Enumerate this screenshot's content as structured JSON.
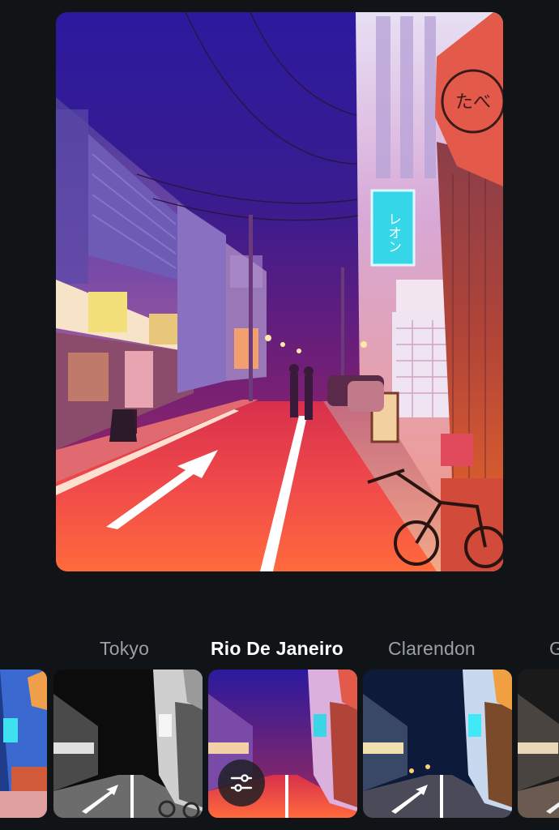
{
  "editor": {
    "selected_filter": "Rio De Janeiro",
    "filters": [
      {
        "label": "Tokyo"
      },
      {
        "label": "Rio De Janeiro"
      },
      {
        "label": "Clarendon"
      },
      {
        "label": "G"
      }
    ],
    "photo_signs": {
      "blue_sign": "レオン",
      "hanging_sign": "たべ"
    },
    "icons": {
      "adjust": "sliders-icon"
    }
  }
}
